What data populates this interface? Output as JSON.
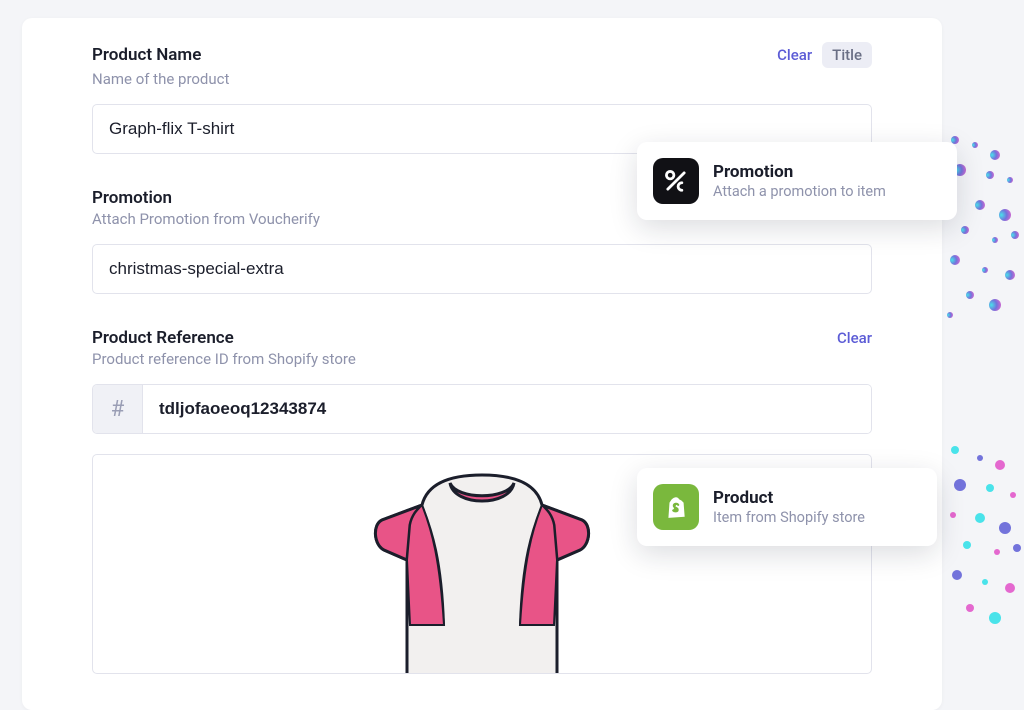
{
  "fields": {
    "productName": {
      "label": "Product Name",
      "description": "Name of the product",
      "value": "Graph-flix T-shirt",
      "clear": "Clear",
      "titleBadge": "Title"
    },
    "promotion": {
      "label": "Promotion",
      "description": "Attach Promotion from Voucherify",
      "value": "christmas-special-extra"
    },
    "productReference": {
      "label": "Product Reference",
      "description": "Product reference ID from Shopify store",
      "value": "tdljofaoeoq12343874",
      "clear": "Clear",
      "hash": "#"
    }
  },
  "cards": {
    "promotion": {
      "title": "Promotion",
      "subtitle": "Attach a promotion to item"
    },
    "product": {
      "title": "Product",
      "subtitle": "Item from Shopify store"
    }
  }
}
